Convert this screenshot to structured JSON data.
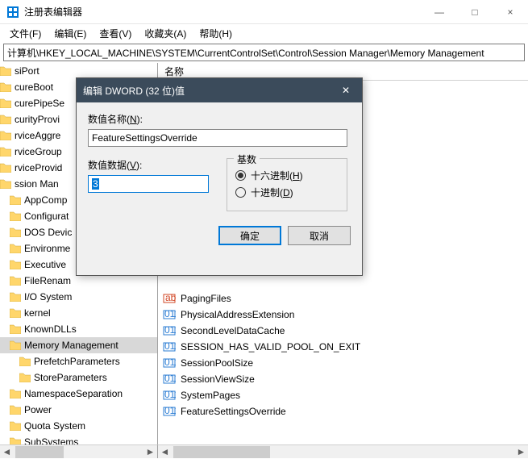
{
  "window": {
    "title": "注册表编辑器",
    "min": "—",
    "max": "□",
    "close": "×"
  },
  "menubar": {
    "file": "文件(F)",
    "edit": "编辑(E)",
    "view": "查看(V)",
    "fav": "收藏夹(A)",
    "help": "帮助(H)"
  },
  "path": "计算机\\HKEY_LOCAL_MACHINE\\SYSTEM\\CurrentControlSet\\Control\\Session Manager\\Memory Management",
  "tree": [
    {
      "label": "siPort",
      "indent": false
    },
    {
      "label": "cureBoot",
      "indent": false
    },
    {
      "label": "curePipeSe",
      "indent": false
    },
    {
      "label": "curityProvi",
      "indent": false
    },
    {
      "label": "rviceAggre",
      "indent": false
    },
    {
      "label": "rviceGroup",
      "indent": false
    },
    {
      "label": "rviceProvid",
      "indent": false
    },
    {
      "label": "ssion Man",
      "indent": false
    },
    {
      "label": "AppComp",
      "indent": true
    },
    {
      "label": "Configurat",
      "indent": true
    },
    {
      "label": "DOS Devic",
      "indent": true
    },
    {
      "label": "Environme",
      "indent": true
    },
    {
      "label": "Executive",
      "indent": true
    },
    {
      "label": "FileRenam",
      "indent": true
    },
    {
      "label": "I/O System",
      "indent": true
    },
    {
      "label": "kernel",
      "indent": true
    },
    {
      "label": "KnownDLLs",
      "indent": true
    },
    {
      "label": "Memory Management",
      "indent": true,
      "selected": true
    },
    {
      "label": "PrefetchParameters",
      "indent": true,
      "sub": true
    },
    {
      "label": "StoreParameters",
      "indent": true,
      "sub": true
    },
    {
      "label": "NamespaceSeparation",
      "indent": true
    },
    {
      "label": "Power",
      "indent": true
    },
    {
      "label": "Quota System",
      "indent": true
    },
    {
      "label": "SubSystems",
      "indent": true
    }
  ],
  "list": {
    "header": "名称",
    "rows": [
      {
        "label": "PagingFiles",
        "type": "sz"
      },
      {
        "label": "PhysicalAddressExtension",
        "type": "dw"
      },
      {
        "label": "SecondLevelDataCache",
        "type": "dw"
      },
      {
        "label": "SESSION_HAS_VALID_POOL_ON_EXIT",
        "type": "dw"
      },
      {
        "label": "SessionPoolSize",
        "type": "dw"
      },
      {
        "label": "SessionViewSize",
        "type": "dw"
      },
      {
        "label": "SystemPages",
        "type": "dw"
      },
      {
        "label": "FeatureSettingsOverride",
        "type": "dw"
      }
    ]
  },
  "dialog": {
    "title": "编辑 DWORD (32 位)值",
    "name_label_pre": "数值名称(",
    "name_label_u": "N",
    "name_label_post": "):",
    "name_value": "FeatureSettingsOverride",
    "data_label_pre": "数值数据(",
    "data_label_u": "V",
    "data_label_post": "):",
    "data_value": "3",
    "base_label": "基数",
    "hex_pre": "十六进制(",
    "hex_u": "H",
    "hex_post": ")",
    "dec_pre": "十进制(",
    "dec_u": "D",
    "dec_post": ")",
    "ok": "确定",
    "cancel": "取消",
    "close": "✕"
  },
  "colors": {
    "dialog_title_bg": "#3b4b5b",
    "selection_bg": "#0078d7",
    "folder": "#ffd66b"
  }
}
